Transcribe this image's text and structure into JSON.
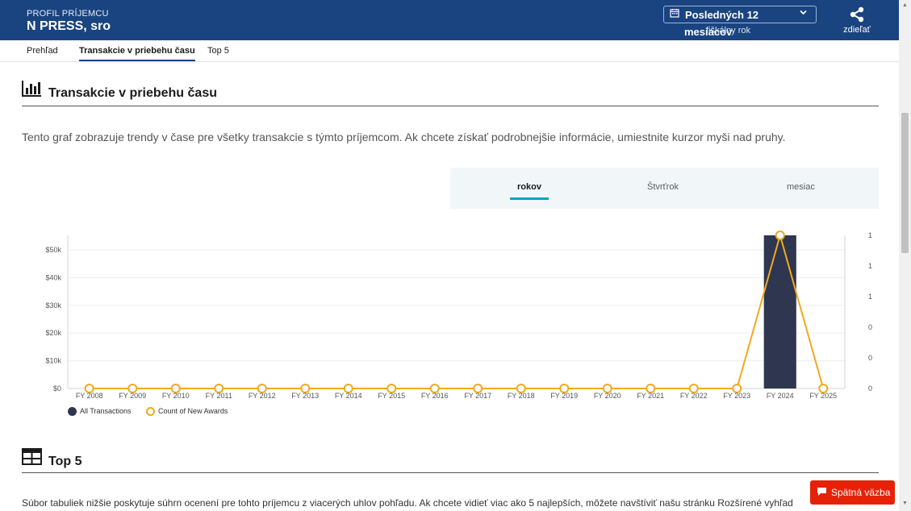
{
  "header": {
    "kicker": "PROFIL PRÍJEMCU",
    "recipient_name": "N PRESS, sro",
    "fiscal_select_line1": "Posledných 12",
    "fiscal_select_line2": "mesiacov",
    "fiscal_select_sub": "fiškálny rok",
    "share_label": "zdieľať"
  },
  "tabs": [
    {
      "label": "Prehľad",
      "active": false
    },
    {
      "label": "Transakcie v priebehu času",
      "active": true
    },
    {
      "label": "Top 5",
      "active": false
    }
  ],
  "section_time": {
    "title": "Transakcie v priebehu času",
    "icon": "bar-chart-icon",
    "description": "Tento graf zobrazuje trendy v čase pre všetky transakcie s týmto príjemcom. Ak chcete získať podrobnejšie informácie, umiestnite kurzor myši nad pruhy."
  },
  "period_toggle": [
    {
      "label": "rokov",
      "active": true
    },
    {
      "label": "Štvrťrok",
      "active": false
    },
    {
      "label": "mesiac",
      "active": false
    }
  ],
  "chart_data": {
    "type": "bar",
    "categories": [
      "FY 2008",
      "FY 2009",
      "FY 2010",
      "FY 2011",
      "FY 2012",
      "FY 2013",
      "FY 2014",
      "FY 2015",
      "FY 2016",
      "FY 2017",
      "FY 2018",
      "FY 2019",
      "FY 2020",
      "FY 2021",
      "FY 2022",
      "FY 2023",
      "FY 2024",
      "FY 2025"
    ],
    "series": [
      {
        "name": "All Transactions",
        "kind": "bar",
        "axis": "left",
        "color": "#2e3650",
        "values": [
          0,
          0,
          0,
          0,
          0,
          0,
          0,
          0,
          0,
          0,
          0,
          0,
          0,
          0,
          0,
          0,
          55000,
          0
        ]
      },
      {
        "name": "Count of New Awards",
        "kind": "line",
        "axis": "right",
        "color": "#f2a91e",
        "values": [
          0,
          0,
          0,
          0,
          0,
          0,
          0,
          0,
          0,
          0,
          0,
          0,
          0,
          0,
          0,
          0,
          1,
          0
        ]
      }
    ],
    "y_left_ticks": [
      "$0",
      "$10k",
      "$20k",
      "$30k",
      "$40k",
      "$50k"
    ],
    "y_left_range": [
      0,
      55000
    ],
    "y_right_ticks": [
      "0",
      "0",
      "0",
      "1",
      "1",
      "1"
    ],
    "y_right_range": [
      0,
      1
    ],
    "grid": true,
    "legend_position": "bottom-left"
  },
  "section_top5": {
    "title": "Top 5",
    "icon": "table-icon",
    "description": "Súbor tabuliek nižšie poskytuje súhrn ocenení pre tohto príjemcu z viacerých uhlov pohľadu. Ak chcete vidieť viac ako 5 najlepších, môžete navštíviť našu stránku Rozšírené vyhľad"
  },
  "feedback": {
    "label": "Spätná väzba"
  },
  "colors": {
    "header_bg": "#1a4480",
    "accent": "#00a5c2",
    "feedback": "#e52207"
  }
}
